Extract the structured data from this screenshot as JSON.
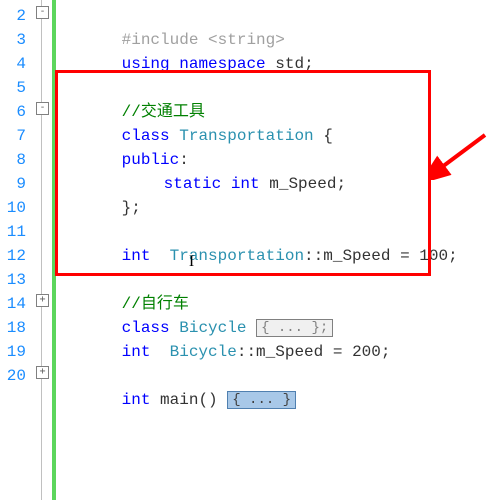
{
  "line_numbers": [
    "2",
    "3",
    "4",
    "5",
    "6",
    "7",
    "8",
    "9",
    "10",
    "11",
    "12",
    "13",
    "14",
    "18",
    "19",
    "20"
  ],
  "lines": {
    "l2": {
      "pre": "#include ",
      "open": "<",
      "hdr": "string",
      "close": ">"
    },
    "l3": {
      "kw1": "using",
      "sp1": " ",
      "kw2": "namespace",
      "sp2": " ",
      "id": "std",
      "semi": ";"
    },
    "l5": {
      "comment": "//交通工具"
    },
    "l6": {
      "kw": "class",
      "sp": " ",
      "type": "Transportation",
      "rest": " {"
    },
    "l7": {
      "kw": "public",
      "colon": ":"
    },
    "l8": {
      "kw1": "static",
      "sp1": " ",
      "kw2": "int",
      "sp2": " ",
      "id": "m_Speed",
      "semi": ";"
    },
    "l9": {
      "brace": "};"
    },
    "l11": {
      "kw": "int",
      "sp1": "  ",
      "type": "Transportation",
      "scope": "::",
      "id": "m_Speed",
      "eq": " = ",
      "num": "100",
      "semi": ";"
    },
    "l13": {
      "comment": "//自行车"
    },
    "l14": {
      "kw": "class",
      "sp": " ",
      "type": "Bicycle",
      "fold": "{ ... };"
    },
    "l18": {
      "kw": "int",
      "sp1": "  ",
      "type": "Bicycle",
      "scope": "::",
      "id": "m_Speed",
      "eq": " = ",
      "num": "200",
      "semi": ";"
    },
    "l20": {
      "kw": "int",
      "sp": " ",
      "fn": "main",
      "paren": "()",
      "fold": "{ ... }"
    }
  },
  "annotations": {
    "redbox_desc": "Red highlight box around Transportation class definition and static member init",
    "arrow_desc": "Red arrow pointing to highlighted region"
  }
}
